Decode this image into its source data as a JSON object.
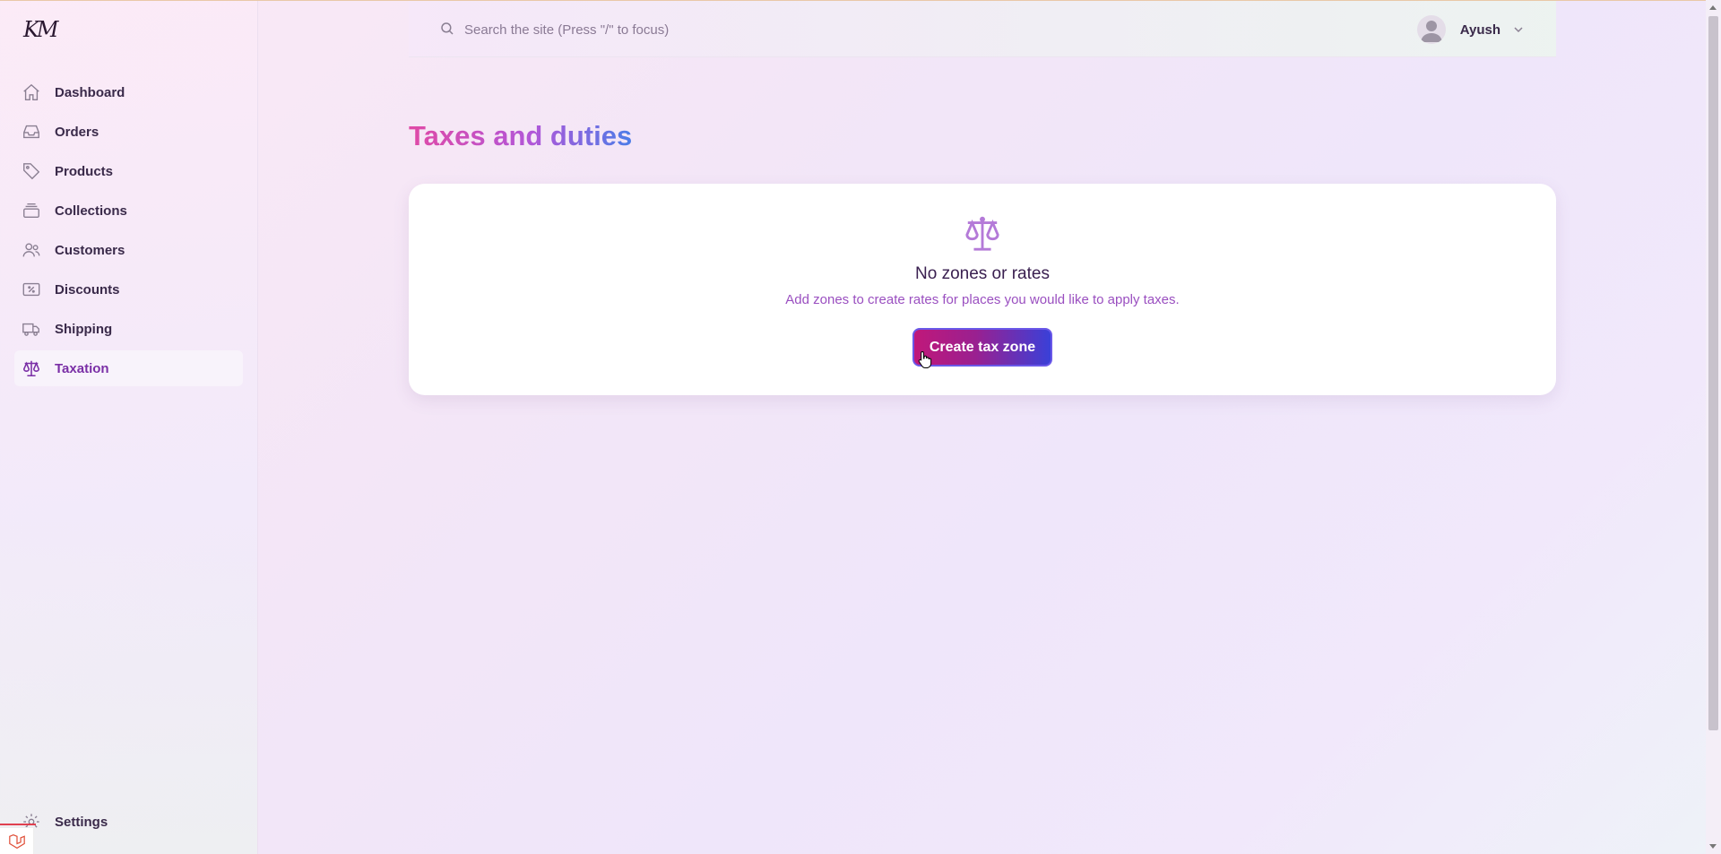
{
  "brand": {
    "logo": "KM"
  },
  "sidebar": {
    "items": [
      {
        "label": "Dashboard",
        "icon": "home-icon"
      },
      {
        "label": "Orders",
        "icon": "inbox-icon"
      },
      {
        "label": "Products",
        "icon": "tag-icon"
      },
      {
        "label": "Collections",
        "icon": "stack-icon"
      },
      {
        "label": "Customers",
        "icon": "users-icon"
      },
      {
        "label": "Discounts",
        "icon": "ticket-icon"
      },
      {
        "label": "Shipping",
        "icon": "truck-icon"
      },
      {
        "label": "Taxation",
        "icon": "scale-icon",
        "active": true
      }
    ],
    "settings_label": "Settings"
  },
  "header": {
    "search_placeholder": "Search the site (Press \"/\" to focus)",
    "user_name": "Ayush"
  },
  "main": {
    "title": "Taxes and duties",
    "empty_state": {
      "icon": "scale-icon",
      "title": "No zones or rates",
      "description": "Add zones to create rates for places you would like to apply taxes.",
      "button_label": "Create tax zone"
    }
  },
  "colors": {
    "accent": "#7a2fa6",
    "title_gradient_start": "#e04aa6",
    "title_gradient_end": "#4b7de8",
    "button_gradient_start": "#c0187a",
    "button_gradient_end": "#3a40d8"
  }
}
